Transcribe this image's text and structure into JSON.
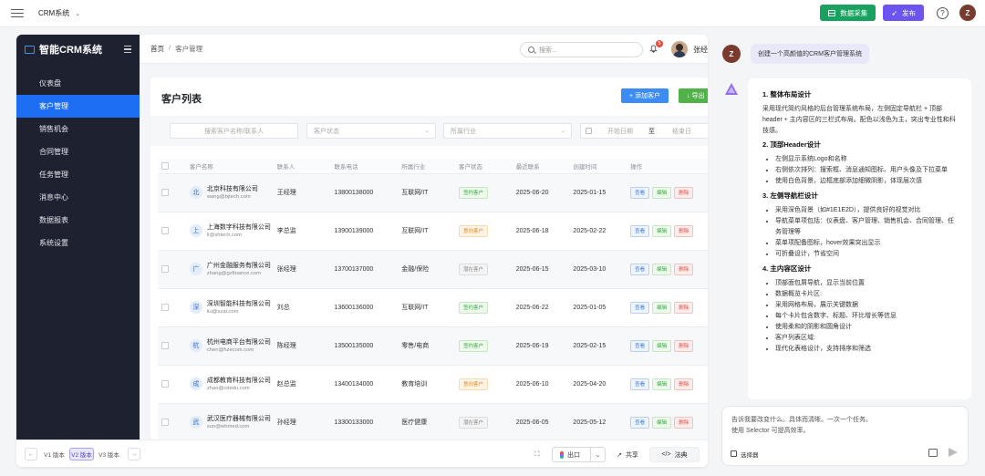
{
  "topbar": {
    "project_name": "CRM系统",
    "collect_label": "数据采集",
    "publish_label": "发布",
    "help_label": "?",
    "user_initial": "Z"
  },
  "preview": {
    "logo_text": "智能CRM系统",
    "nav": [
      {
        "label": "仪表盘",
        "active": false
      },
      {
        "label": "客户管理",
        "active": true
      },
      {
        "label": "销售机会",
        "active": false
      },
      {
        "label": "合同管理",
        "active": false
      },
      {
        "label": "任务管理",
        "active": false
      },
      {
        "label": "消息中心",
        "active": false
      },
      {
        "label": "数据报表",
        "active": false
      },
      {
        "label": "系统设置",
        "active": false
      }
    ],
    "breadcrumb": {
      "home": "首页",
      "sep": "/",
      "current": "客户管理"
    },
    "search_placeholder": "搜索...",
    "notification_count": "5",
    "user_name": "张经",
    "card_title": "客户列表",
    "add_button": "+ 添加客户",
    "export_button": "↓ 导出",
    "filters": {
      "search_placeholder": "搜索客户名称/联系人",
      "status_placeholder": "客户状态",
      "industry_placeholder": "所属行业",
      "start_date": "开始日期",
      "to": "至",
      "end_date": "结束日"
    },
    "columns": [
      "客户名称",
      "联系人",
      "联系电话",
      "所属行业",
      "客户状态",
      "最近联系",
      "创建时间",
      "操作"
    ],
    "rows": [
      {
        "avatar": "北",
        "name": "北京科技有限公司",
        "email": "wang@bjtech.com",
        "contact": "王经理",
        "phone": "13800138000",
        "industry": "互联网/IT",
        "status": "签约客户",
        "status_type": "sign",
        "last_contact": "2025-06-20",
        "created": "2025-01-15"
      },
      {
        "avatar": "上",
        "name": "上海数字科技有限公司",
        "email": "li@shtech.com",
        "contact": "李总监",
        "phone": "13900139000",
        "industry": "互联网/IT",
        "status": "意向客户",
        "status_type": "int",
        "last_contact": "2025-06-18",
        "created": "2025-02-22"
      },
      {
        "avatar": "广",
        "name": "广州金融服务有限公司",
        "email": "zhang@gzfinance.com",
        "contact": "张经理",
        "phone": "13700137000",
        "industry": "金融/保险",
        "status": "潜在客户",
        "status_type": "pot",
        "last_contact": "2025-06-15",
        "created": "2025-03-10"
      },
      {
        "avatar": "深",
        "name": "深圳智能科技有限公司",
        "email": "liu@szai.com",
        "contact": "刘总",
        "phone": "13600136000",
        "industry": "互联网/IT",
        "status": "签约客户",
        "status_type": "sign",
        "last_contact": "2025-06-22",
        "created": "2025-01-05"
      },
      {
        "avatar": "杭",
        "name": "杭州电商平台有限公司",
        "email": "chen@hzecom.com",
        "contact": "陈经理",
        "phone": "13500135000",
        "industry": "零售/电商",
        "status": "签约客户",
        "status_type": "sign",
        "last_contact": "2025-06-19",
        "created": "2025-02-15"
      },
      {
        "avatar": "成",
        "name": "成都教育科技有限公司",
        "email": "zhao@cdedu.com",
        "contact": "赵总监",
        "phone": "13400134000",
        "industry": "教育培训",
        "status": "意向客户",
        "status_type": "int",
        "last_contact": "2025-06-10",
        "created": "2025-04-20"
      },
      {
        "avatar": "武",
        "name": "武汉医疗器械有限公司",
        "email": "sun@whmed.com",
        "contact": "孙经理",
        "phone": "13300133000",
        "industry": "医疗健康",
        "status": "潜在客户",
        "status_type": "pot",
        "last_contact": "2025-06-05",
        "created": "2025-05-12"
      }
    ],
    "actions": {
      "view": "查看",
      "edit": "编辑",
      "delete": "删除"
    }
  },
  "bottombar": {
    "versions": [
      "V1 版本",
      "V2 版本",
      "V3 版本"
    ],
    "active_version": "V2 版本",
    "export_label": "出口",
    "share_label": "共享",
    "code_label": "法典"
  },
  "chat": {
    "user_initial": "Z",
    "user_message": "创建一个高颜值的CRM客户管理系统",
    "sections": [
      {
        "title": "1. 整体布局设计",
        "text": "采用现代简约风格的后台管理系统布局，左侧固定导航栏 + 顶部header + 主内容区的三栏式布局。配色以浅色为主，突出专业性和科技感。",
        "items": []
      },
      {
        "title": "2. 顶部Header设计",
        "text": "",
        "items": [
          "左侧显示系统Logo和名称",
          "右侧依次排列：搜索框、消息通知图标、用户头像及下拉菜单",
          "使用白色背景，边框底部添加细微阴影，体现层次感"
        ]
      },
      {
        "title": "3. 左侧导航栏设计",
        "text": "",
        "items": [
          "采用深色背景（如#1E1E2D），提供良好的视觉对比",
          "导航菜单项包括：仪表盘、客户管理、销售机会、合同管理、任务管理等",
          "菜单项配备图标，hover效果突出显示",
          "可折叠设计，节省空间"
        ]
      },
      {
        "title": "4. 主内容区设计",
        "text": "",
        "items": [
          "顶部面包屑导航，显示当前位置",
          "数据概览卡片区:",
          "采用网格布局，展示关键数据",
          "每个卡片包含数字、标题、环比增长等信息",
          "使用柔和的阴影和圆角设计",
          "客户列表区域:",
          "现代化表格设计，支持排序和筛选"
        ]
      }
    ],
    "composer_line1": "告诉我要改变什么。具体而清晰。一次一个任务。",
    "composer_line2": "使用 Selector 可提高效率。",
    "selector_label": "选择器"
  }
}
